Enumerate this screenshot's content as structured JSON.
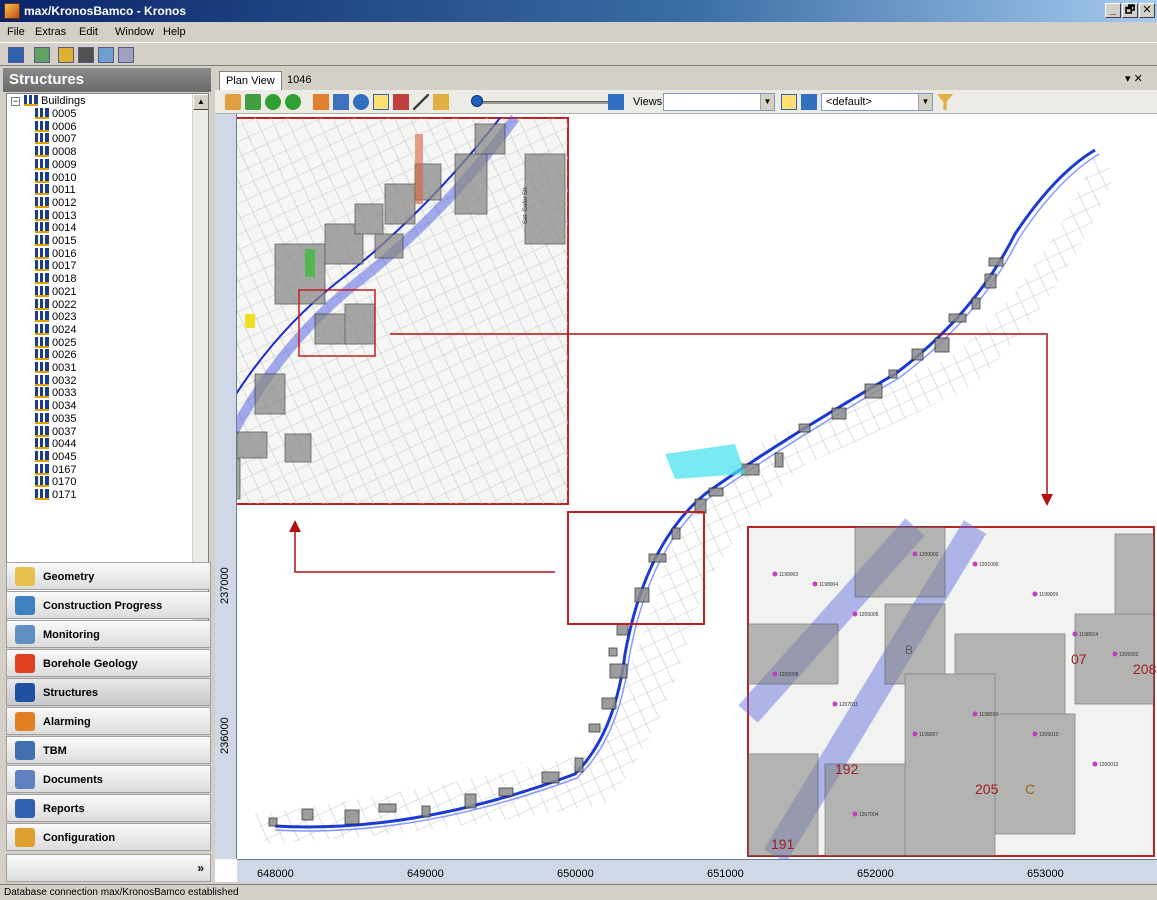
{
  "window": {
    "title": "max/KronosBamco - Kronos",
    "min": "_",
    "restore": "🗗",
    "close": "✕"
  },
  "menu": [
    "File",
    "Extras",
    "Edit",
    "Window",
    "Help"
  ],
  "left_panel": {
    "header": "Structures",
    "tree_root": "Buildings",
    "tree_items": [
      "0005",
      "0006",
      "0007",
      "0008",
      "0009",
      "0010",
      "0011",
      "0012",
      "0013",
      "0014",
      "0015",
      "0016",
      "0017",
      "0018",
      "0021",
      "0022",
      "0023",
      "0024",
      "0025",
      "0026",
      "0031",
      "0032",
      "0033",
      "0034",
      "0035",
      "0037",
      "0044",
      "0045",
      "0167",
      "0170",
      "0171"
    ],
    "nav": [
      "Geometry",
      "Construction Progress",
      "Monitoring",
      "Borehole Geology",
      "Structures",
      "Alarming",
      "TBM",
      "Documents",
      "Reports",
      "Configuration"
    ],
    "active_nav": "Structures",
    "more_glyph": "»"
  },
  "tabs": [
    "Plan View",
    "1046"
  ],
  "tab_controls": "▾ ✕",
  "map_toolbar": {
    "views_label": "Views",
    "views_value": "",
    "style_value": "<default>"
  },
  "map": {
    "x_ticks": [
      "648000",
      "649000",
      "650000",
      "651000",
      "652000",
      "653000"
    ],
    "y_ticks": [
      "237000",
      "236000"
    ],
    "inset_labels": [
      "191",
      "192",
      "205",
      "208",
      "07",
      "B",
      "C"
    ],
    "detail_point_ids": [
      "1199002",
      "1198004",
      "1205005",
      "1200003",
      "1201000",
      "1199009",
      "1198014",
      "1205002",
      "1200008",
      "1207011",
      "1199007",
      "1198010",
      "1205010",
      "1200012",
      "1207004"
    ],
    "street_label": "Sat. Gafer Str."
  },
  "status": "Database connection max/KronosBamco established"
}
